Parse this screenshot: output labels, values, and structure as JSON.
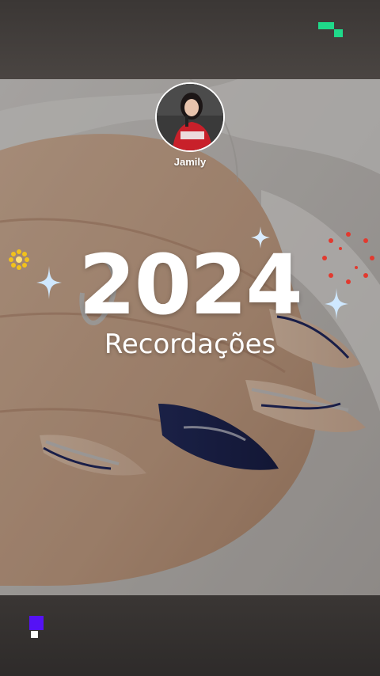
{
  "profile": {
    "username": "Jamily"
  },
  "headline": {
    "year": "2024",
    "subtitle": "Recordações"
  },
  "brand": {
    "top_mark_color": "#1fd98a",
    "bottom_mark_color": "#5512f5"
  },
  "decorations": {
    "sparkle_color": "#cfe8ff",
    "flower_color": "#f2c21b",
    "burst_color": "#e23a2f"
  }
}
